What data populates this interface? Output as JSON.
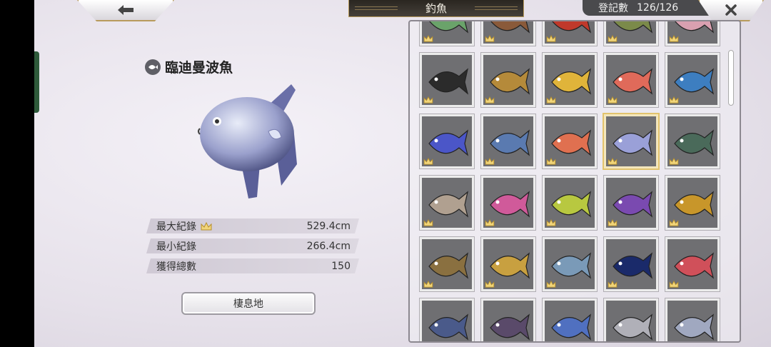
{
  "header": {
    "title": "釣魚",
    "count_label": "登記數",
    "count_value": "126/126"
  },
  "detail": {
    "fish_name": "臨迪曼波魚",
    "stats": [
      {
        "label": "最大紀錄",
        "value": "529.4cm",
        "icon": "crown-icon"
      },
      {
        "label": "最小紀錄",
        "value": "266.4cm"
      },
      {
        "label": "獲得總數",
        "value": "150"
      }
    ],
    "habitat_button": "棲息地"
  },
  "grid": {
    "columns": 5,
    "selected_index": 13,
    "cells": [
      {
        "fish": "green-frogfish",
        "color": "#6aa36a"
      },
      {
        "fish": "brown-crab",
        "color": "#8a5a3a"
      },
      {
        "fish": "red-lobster",
        "color": "#c0392b"
      },
      {
        "fish": "green-turtle",
        "color": "#7b8a4a"
      },
      {
        "fish": "pink-shrimp",
        "color": "#d9a0b0"
      },
      {
        "fish": "black-gold-koi",
        "color": "#2b2b2b"
      },
      {
        "fish": "tiger-catfish",
        "color": "#b58a3a"
      },
      {
        "fish": "golden-tuna",
        "color": "#e0b43a"
      },
      {
        "fish": "red-snapper",
        "color": "#e06a5a"
      },
      {
        "fish": "blue-grouper",
        "color": "#3d7ec0"
      },
      {
        "fish": "blue-dragon",
        "color": "#4b56c8"
      },
      {
        "fish": "swordfish",
        "color": "#5a7ab0"
      },
      {
        "fish": "red-salmon",
        "color": "#e07050"
      },
      {
        "fish": "ocean-sunfish",
        "color": "#9aa0d8"
      },
      {
        "fish": "spiky-crab",
        "color": "#4a6a5a"
      },
      {
        "fish": "silver-carp",
        "color": "#b0a090"
      },
      {
        "fish": "tuna-pink",
        "color": "#d05a9a"
      },
      {
        "fish": "mahi-mahi",
        "color": "#b8c840"
      },
      {
        "fish": "purple-seahorse",
        "color": "#7a4ab0"
      },
      {
        "fish": "golden-seahorse",
        "color": "#c8962a"
      },
      {
        "fish": "moray-eel",
        "color": "#8a7040"
      },
      {
        "fish": "golden-pike",
        "color": "#c8a040"
      },
      {
        "fish": "mackerel",
        "color": "#7a9ab8"
      },
      {
        "fish": "spotted-ray",
        "color": "#1a2a6a"
      },
      {
        "fish": "neon-tetra",
        "color": "#d0505a"
      },
      {
        "fish": "blue-crab",
        "color": "#4a5a8a"
      },
      {
        "fish": "anglerfish",
        "color": "#5a4a6a"
      },
      {
        "fish": "flying-fish",
        "color": "#5070c0"
      },
      {
        "fish": "white-shark",
        "color": "#b0b0b8"
      },
      {
        "fish": "white-marlin",
        "color": "#a0a8c0"
      }
    ]
  }
}
